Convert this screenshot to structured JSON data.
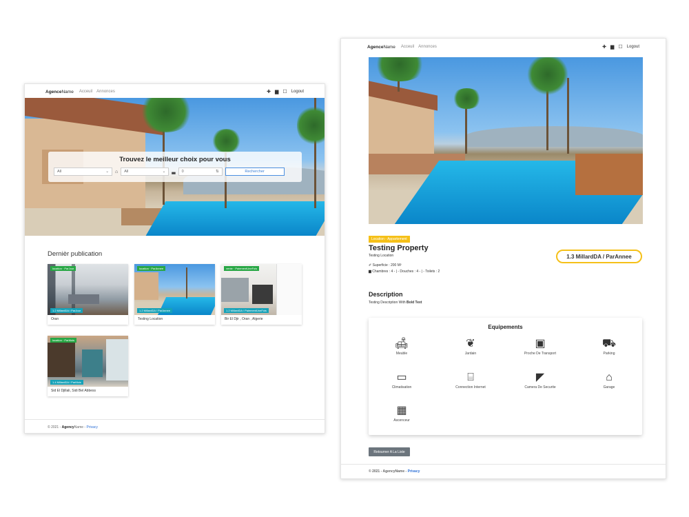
{
  "left_window": {
    "navbar": {
      "brand_bold": "Agence",
      "brand_rest": "Name",
      "links": [
        "Acceuil",
        "Annonces"
      ],
      "icons": [
        "plus-icon",
        "bed-icon",
        "calendar-icon"
      ],
      "logout": "Logout"
    },
    "hero": {
      "title": "Trouvez le meilleur choix pour vous",
      "select_1": "All",
      "select_2": "All",
      "bed_input_value": "0",
      "search_button": "Rechercher"
    },
    "latest_title": "Dernièr publication",
    "listings": [
      {
        "badge_top": "location · ParJour",
        "price": "1.2 MillardDA / ParJour",
        "caption": "Oran"
      },
      {
        "badge_top": "location · ParAnnee",
        "price": "1.2 MillardDA / ParAnnee",
        "caption": "Testing Location"
      },
      {
        "badge_top": "vente · PaiementUneFois",
        "price": "1.2 MillardDA / PaiementUneFois",
        "caption": "Bir El Djir , Oran , Algerie"
      },
      {
        "badge_top": "location · ParMois",
        "price": "1.4 MillardDA / ParMois",
        "caption": "Sid El Djillali, Sidi Bel Abbess"
      }
    ],
    "footer": {
      "prefix": "© 2021 - ",
      "brand_bold": "Agency",
      "brand_rest": "Name",
      "sep": " - ",
      "privacy": "Privacy"
    }
  },
  "right_window": {
    "navbar": {
      "brand_bold": "Agence",
      "brand_rest": "Name",
      "links": [
        "Acceuil",
        "Annonces"
      ],
      "logout": "Logout"
    },
    "badge": "Location - Appartement",
    "title": "Testing Property",
    "location": "Testing Location",
    "superficie": "Superficie : 200 M²",
    "rooms_line": "Chambres : 4 - | - Douches : 4 - | - Toilets : 2",
    "price": "1.3 MillardDA / ParAnnee",
    "description_title": "Description",
    "description_text": "Testing Description With ",
    "description_bold": "Bold Text",
    "equipements_title": "Equipements",
    "equipements": [
      {
        "icon": "sofa-icon",
        "label": "Meuble"
      },
      {
        "icon": "plant-icon",
        "label": "Jardain"
      },
      {
        "icon": "bus-icon",
        "label": "Proche De Transport"
      },
      {
        "icon": "car-icon",
        "label": "Parking"
      },
      {
        "icon": "air-conditioner-icon",
        "label": "Climatisation"
      },
      {
        "icon": "router-icon",
        "label": "Connection Internet"
      },
      {
        "icon": "camera-icon",
        "label": "Camera De Securite"
      },
      {
        "icon": "garage-icon",
        "label": "Garage"
      },
      {
        "icon": "building-icon",
        "label": "Ascenceur"
      }
    ],
    "back_button": "Retourner A La Liste",
    "footer": {
      "prefix": "© 2021 - ",
      "brand": "AgencyName",
      "sep": " - ",
      "privacy": "Privacy"
    }
  }
}
